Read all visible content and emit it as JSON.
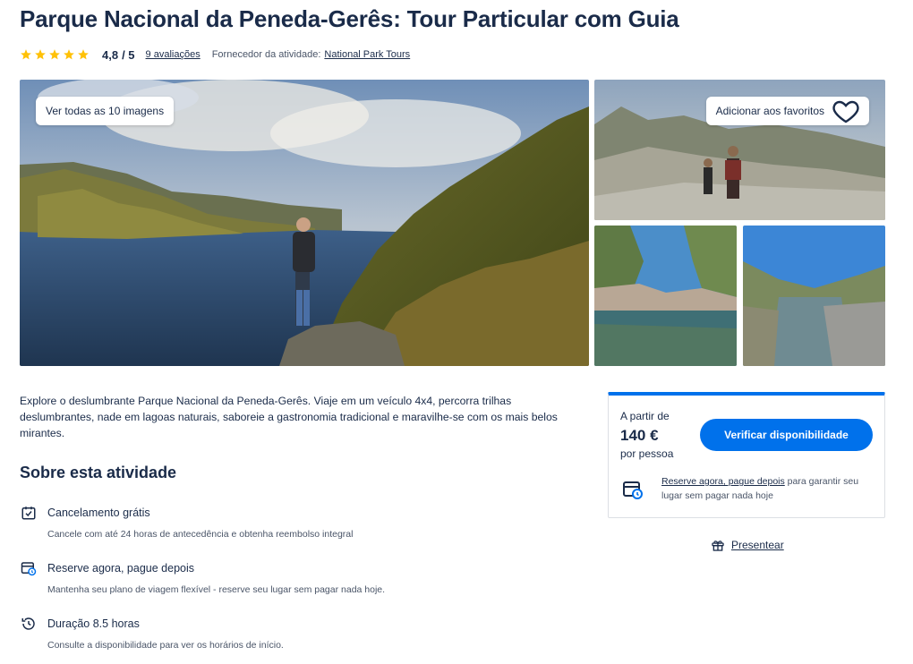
{
  "header": {
    "title": "Parque Nacional da Peneda-Gerês: Tour Particular com Guia",
    "stars_count": 5,
    "star_color": "#ffc107",
    "rating": "4,8",
    "rating_max": "/ 5",
    "reviews_link": "9 avaliações",
    "supplier_label": "Fornecedor da atividade:",
    "supplier_name": "National Park Tours"
  },
  "gallery": {
    "view_all_label": "Ver todas as 10 imagens",
    "favorite_label": "Adicionar aos favoritos"
  },
  "description": "Explore o deslumbrante Parque Nacional da Peneda-Gerês. Viaje em um veículo 4x4, percorra trilhas deslumbrantes, nade em lagoas naturais, saboreie a gastronomia tradicional e maravilhe-se com os mais belos mirantes.",
  "about": {
    "title": "Sobre esta atividade",
    "features": [
      {
        "icon": "calendar-check-icon",
        "title": "Cancelamento grátis",
        "text": "Cancele com até 24 horas de antecedência e obtenha reembolso integral"
      },
      {
        "icon": "calendar-clock-icon",
        "title": "Reserve agora, pague depois",
        "text": "Mantenha seu plano de viagem flexível - reserve seu lugar sem pagar nada hoje."
      },
      {
        "icon": "history-clock-icon",
        "title": "Duração 8.5 horas",
        "text": "Consulte a disponibilidade para ver os horários de início."
      }
    ]
  },
  "booking": {
    "from_label": "A partir de",
    "price": "140 €",
    "per_person": "por pessoa",
    "check_button": "Verificar disponibilidade",
    "reserve_link": "Reserve agora, pague depois",
    "reserve_text": " para garantir seu lugar sem pagar nada hoje",
    "accent_color": "#0071eb"
  },
  "gift": {
    "label": "Presentear"
  }
}
